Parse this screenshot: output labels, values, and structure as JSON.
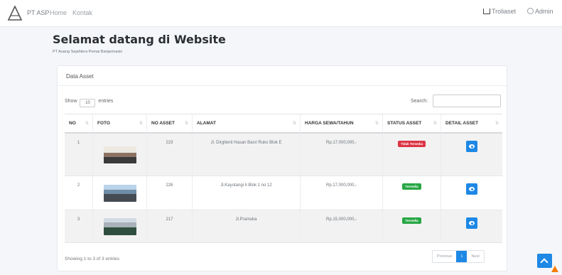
{
  "navbar": {
    "brand": "PT ASP",
    "links": [
      "Home",
      "Kontak"
    ],
    "cart_label": "Troliaset",
    "account_label": "Admin"
  },
  "header": {
    "title": "Selamat datang di Website",
    "subtitle": "PT Auang Sejahtera Pemai Banjarmasin"
  },
  "card": {
    "title": "Data Asset",
    "show_prefix": "Show",
    "show_value": "10",
    "show_suffix": "entries",
    "search_label": "Search:",
    "search_value": ""
  },
  "table": {
    "columns": [
      "NO",
      "FOTO",
      "NO ASSET",
      "ALAMAT",
      "HARGA SEWA/TAHUN",
      "STATUS ASSET",
      "DETAIL ASSET"
    ],
    "rows": [
      {
        "no": "1",
        "photo": "building-photo",
        "no_asset": "223",
        "alamat": "Jl. Dirgilenit Hasan Basri Ruko Blok E",
        "harga": "Rp.17,000,000,-",
        "status": "Tidak Tersedia",
        "status_color": "#dc3545"
      },
      {
        "no": "2",
        "photo": "building-photo",
        "no_asset": "226",
        "alamat": "Jl.Kayutangi Ii Blok 1 no 12",
        "harga": "Rp.17,000,000,-",
        "status": "Tersedia",
        "status_color": "#28a745"
      },
      {
        "no": "3",
        "photo": "building-photo",
        "no_asset": "217",
        "alamat": "Jl.Pramuka",
        "harga": "Rp.15,000,000,-",
        "status": "Tersedia",
        "status_color": "#28a745"
      }
    ]
  },
  "footer": {
    "info": "Showing 1 to 3 of 3 entries",
    "prev": "Previous",
    "page": "1",
    "next": "Next"
  },
  "colors": {
    "accent": "#1e88e5",
    "danger": "#dc3545",
    "success": "#28a745"
  },
  "icons": [
    "logo-icon",
    "cart-icon",
    "user-icon",
    "eye-icon",
    "arrow-up-icon"
  ]
}
